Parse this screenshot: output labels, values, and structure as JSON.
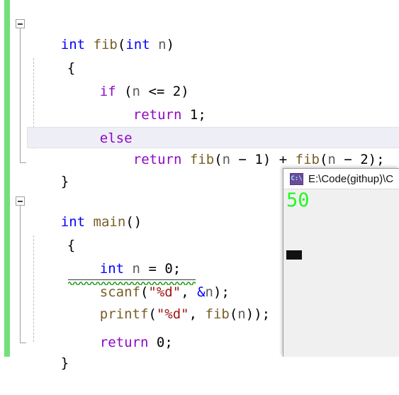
{
  "editor": {
    "change_bar_color": "#72e079",
    "current_line_index": 5,
    "code_lines": [
      {
        "indent": 0,
        "text": "int fib(int n)"
      },
      {
        "indent": 1,
        "text": "{"
      },
      {
        "indent": 2,
        "text": "if (n <= 2)"
      },
      {
        "indent": 3,
        "text": "return 1;"
      },
      {
        "indent": 2,
        "text": "else"
      },
      {
        "indent": 3,
        "text": "return fib(n - 1) + fib(n - 2);"
      },
      {
        "indent": 1,
        "text": "}"
      },
      {
        "indent": 0,
        "text": ""
      },
      {
        "indent": 0,
        "text": "int main()"
      },
      {
        "indent": 1,
        "text": "{"
      },
      {
        "indent": 2,
        "text": "int n = 0;"
      },
      {
        "indent": 2,
        "text": "scanf(\"%d\", &n);"
      },
      {
        "indent": 2,
        "text": "printf(\"%d\", fib(n));"
      },
      {
        "indent": 2,
        "text": "return 0;"
      },
      {
        "indent": 1,
        "text": "}"
      }
    ],
    "outline_regions": [
      {
        "label": "collapse-fib",
        "state": "expanded"
      },
      {
        "label": "collapse-main",
        "state": "expanded"
      }
    ],
    "diagnostics": [
      {
        "line": "scanf(\"%d\", &n);",
        "squiggle_color": "#1f9e1f",
        "kind": "warning"
      }
    ],
    "token_colors": {
      "keyword": "#0000ff",
      "control": "#8f08c4",
      "function": "#795e26",
      "identifier": "#5b5b5b",
      "string": "#a31515",
      "plain": "#000000"
    }
  },
  "console": {
    "icon": "console-cmd-icon",
    "title": "E:\\Code(githup)\\C",
    "output_text": "50",
    "output_color": "#23f723",
    "background": "#f0f0f0",
    "cursor": "block-cursor"
  }
}
